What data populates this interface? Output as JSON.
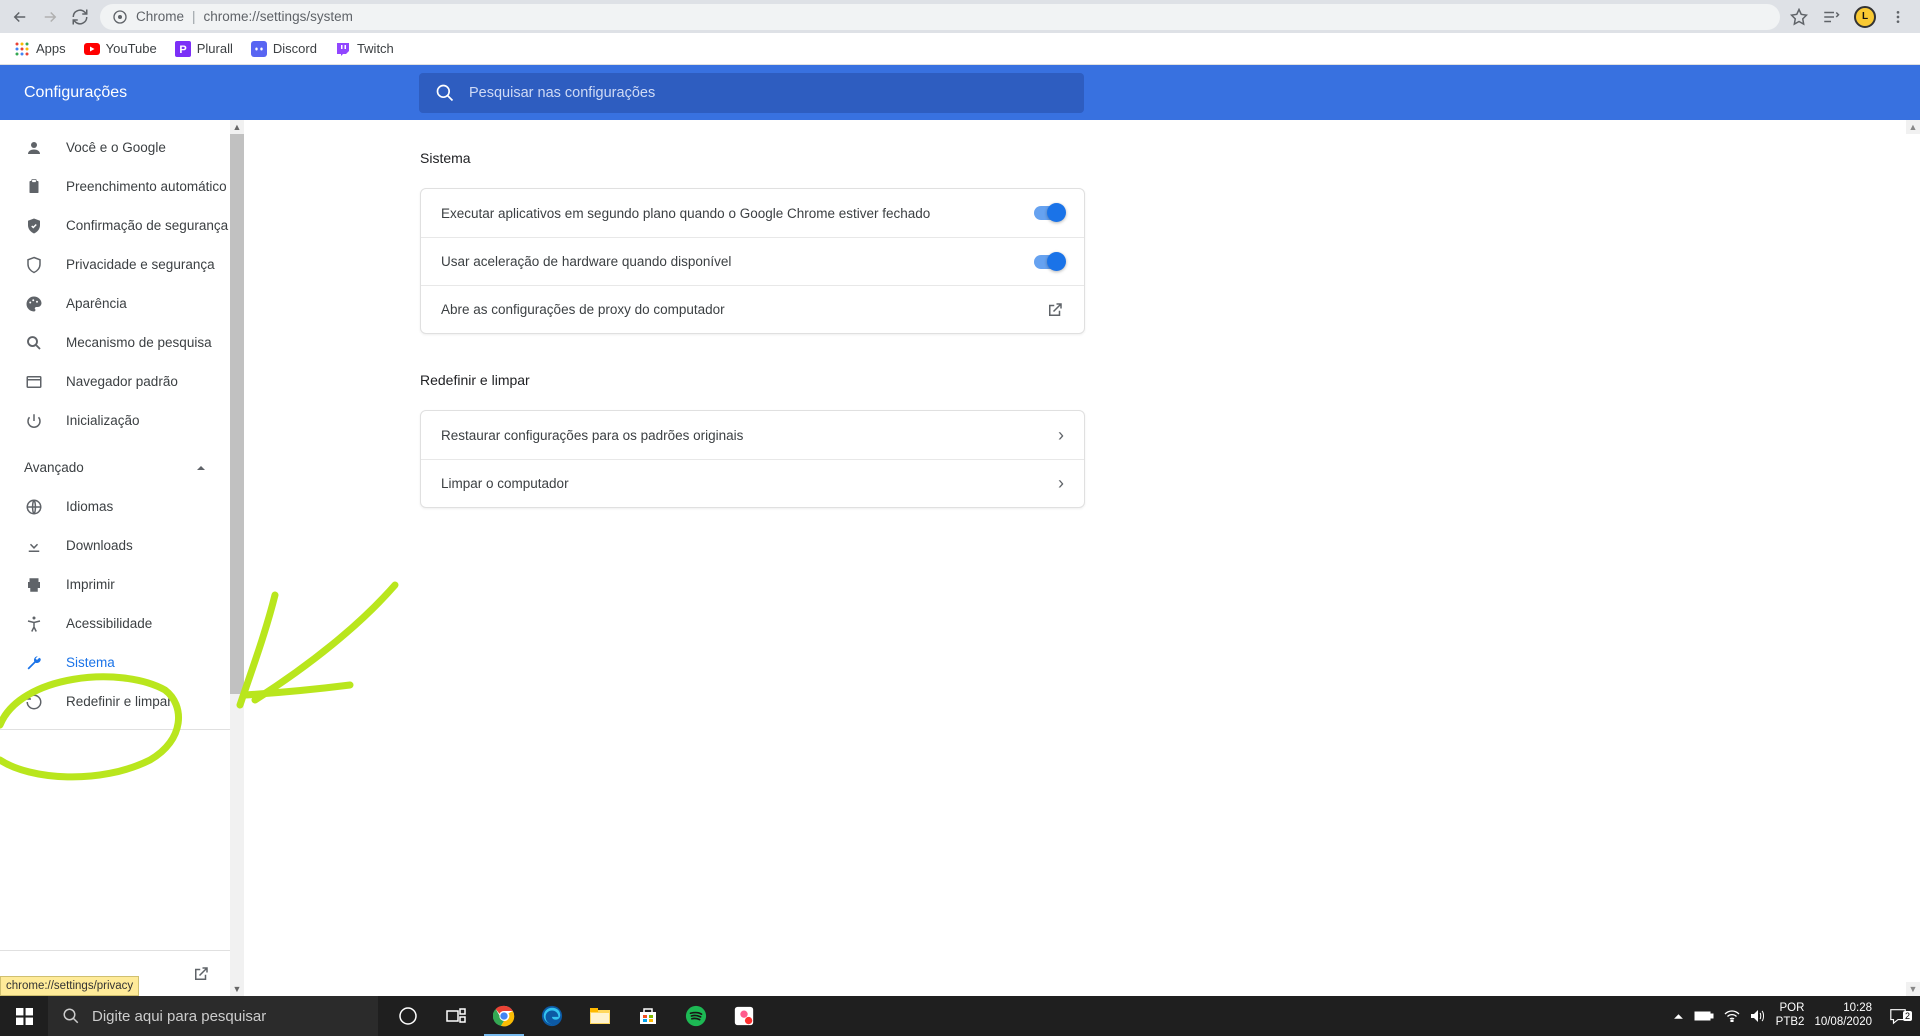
{
  "browser": {
    "url_prefix": "Chrome",
    "url_path": "chrome://settings/system"
  },
  "bookmarks": {
    "apps": "Apps",
    "youtube": "YouTube",
    "plurall": "Plurall",
    "discord": "Discord",
    "twitch": "Twitch"
  },
  "header": {
    "title": "Configurações",
    "search_placeholder": "Pesquisar nas configurações"
  },
  "sidebar": {
    "voce_google": "Você e o Google",
    "preenchimento": "Preenchimento automático",
    "confirmacao": "Confirmação de segurança",
    "privacidade": "Privacidade e segurança",
    "aparencia": "Aparência",
    "mecanismo": "Mecanismo de pesquisa",
    "navegador": "Navegador padrão",
    "inicializacao": "Inicialização",
    "avancado": "Avançado",
    "idiomas": "Idiomas",
    "downloads": "Downloads",
    "imprimir": "Imprimir",
    "acessibilidade": "Acessibilidade",
    "sistema": "Sistema",
    "redefinir": "Redefinir e limpar"
  },
  "main": {
    "sistema_title": "Sistema",
    "bg_apps": "Executar aplicativos em segundo plano quando o Google Chrome estiver fechado",
    "hardware": "Usar aceleração de hardware quando disponível",
    "proxy": "Abre as configurações de proxy do computador",
    "reset_title": "Redefinir e limpar",
    "restore": "Restaurar configurações para os padrões originais",
    "cleanup": "Limpar o computador"
  },
  "tooltip": "chrome://settings/privacy",
  "taskbar": {
    "search_placeholder": "Digite aqui para pesquisar",
    "lang1": "POR",
    "lang2": "PTB2",
    "time": "10:28",
    "date": "10/08/2020",
    "notif_count": "2"
  }
}
